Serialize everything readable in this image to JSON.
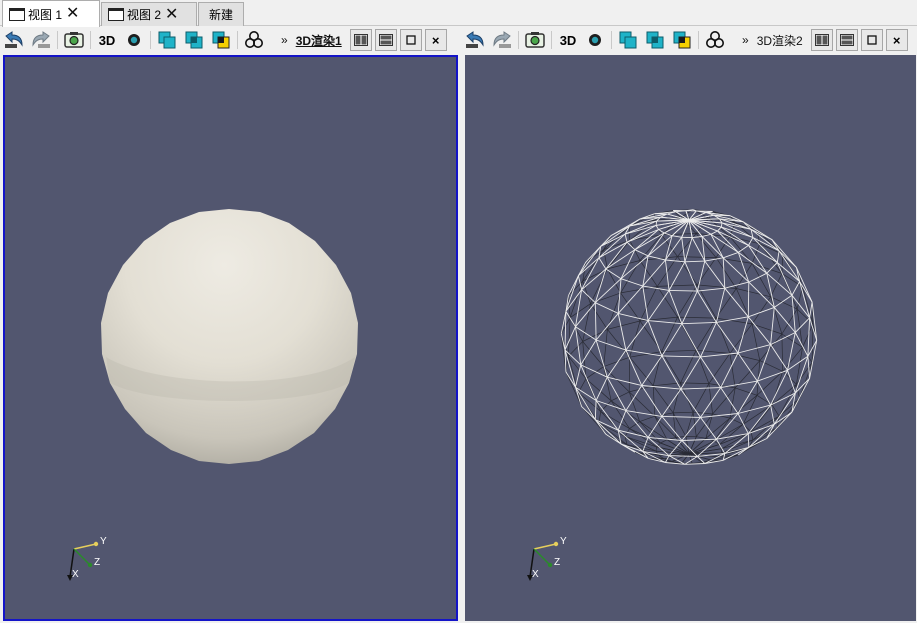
{
  "tabs": [
    {
      "label": "视图 1",
      "active": true
    },
    {
      "label": "视图 2",
      "active": false
    },
    {
      "label": "新建",
      "active": false
    }
  ],
  "toolbar_left": {
    "mode_3d_label": "3D",
    "view_title": "3D渲染1",
    "chevron": "»"
  },
  "toolbar_right": {
    "mode_3d_label": "3D",
    "view_title": "3D渲染2",
    "chevron": "»"
  },
  "frame_buttons": {
    "close_label": "×"
  },
  "axes": {
    "x_label": "X",
    "y_label": "Y",
    "z_label": "Z"
  },
  "colors": {
    "background": "#52566f",
    "active_border": "#1414c8",
    "sphere_surface": "#e8e4da",
    "wireframe": "#e8e8e8",
    "accent_cyan": "#1fb3c8"
  },
  "icons": [
    "undo-camera-icon",
    "redo-camera-icon",
    "capture-screenshot-icon",
    "toggle-3d-icon",
    "interaction-mode-icon",
    "select-cells-icon",
    "select-points-icon",
    "select-block-icon",
    "filters-icon",
    "split-horizontal-icon",
    "split-vertical-icon",
    "maximize-icon",
    "close-view-icon"
  ]
}
